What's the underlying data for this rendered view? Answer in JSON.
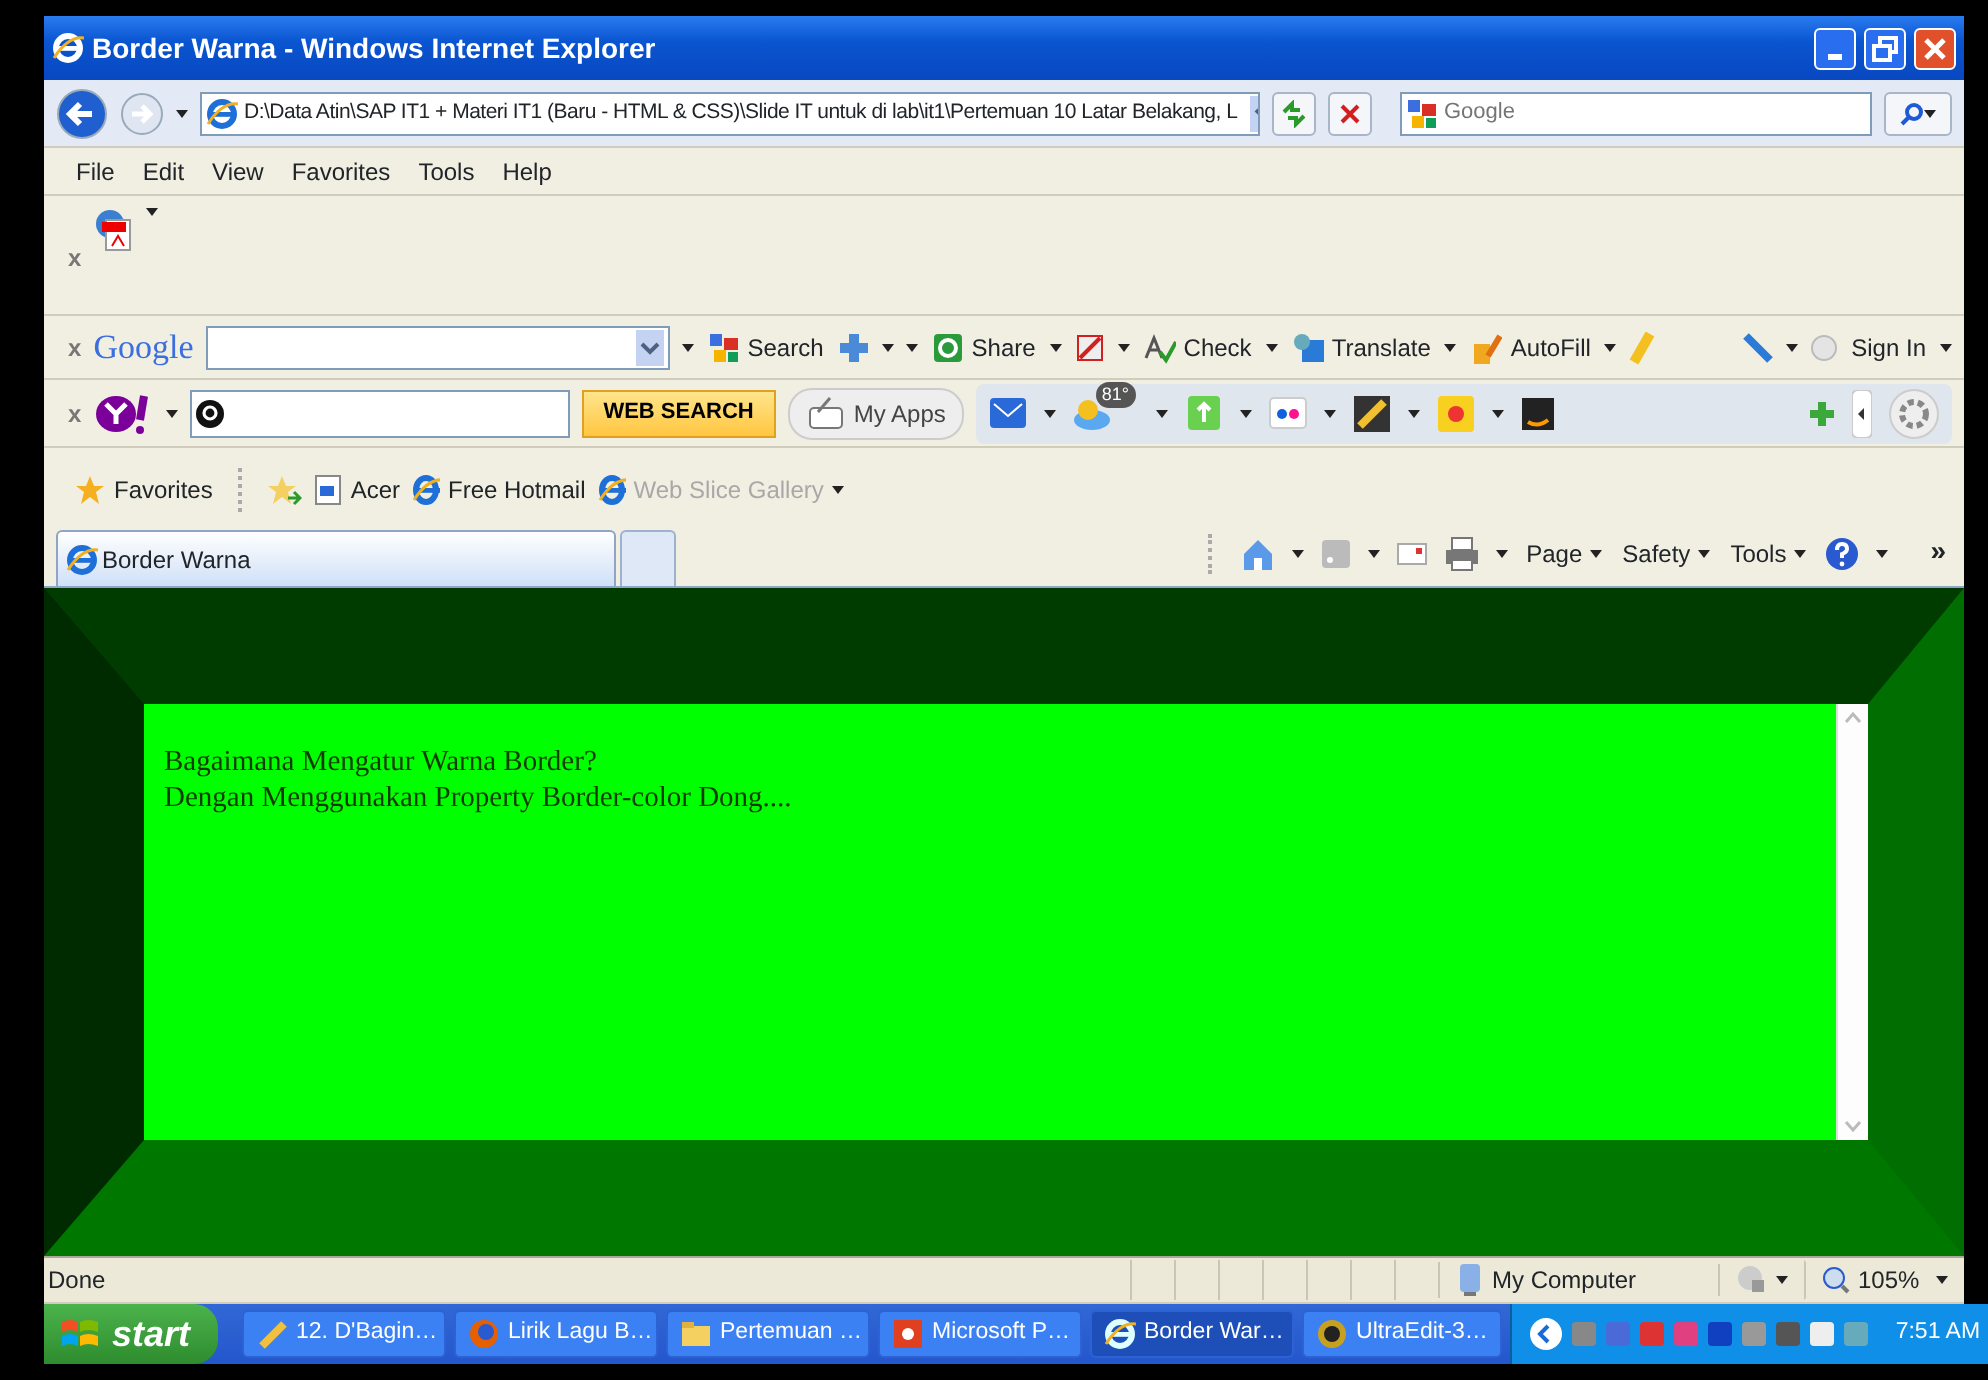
{
  "window": {
    "title": "Border Warna - Windows Internet Explorer"
  },
  "address_bar": {
    "url": "D:\\Data Atin\\SAP IT1 + Materi IT1 (Baru - HTML & CSS)\\Slide IT untuk di lab\\it1\\Pertemuan 10 Latar Belakang, L"
  },
  "search_box": {
    "placeholder": "Google"
  },
  "menu": [
    "File",
    "Edit",
    "View",
    "Favorites",
    "Tools",
    "Help"
  ],
  "pdf_toolbar": {
    "close": "x"
  },
  "google_toolbar": {
    "close": "x",
    "logo": "Google",
    "buttons": [
      "Search",
      "Share",
      "Check",
      "Translate",
      "AutoFill"
    ],
    "sign_in": "Sign In"
  },
  "yahoo_toolbar": {
    "close": "x",
    "search_button": "WEB SEARCH",
    "apps": "My Apps",
    "weather_badge": "81°"
  },
  "favorites_bar": {
    "favorites": "Favorites",
    "links": [
      {
        "label": "Acer",
        "disabled": false
      },
      {
        "label": "Free Hotmail",
        "disabled": false
      },
      {
        "label": "Web Slice Gallery",
        "disabled": true
      }
    ]
  },
  "tabs": [
    {
      "label": "Border Warna",
      "selected": true
    }
  ],
  "command_bar": {
    "menus": [
      "Page",
      "Safety",
      "Tools"
    ],
    "more": "»"
  },
  "page": {
    "lines": [
      "Bagaimana Mengatur Warna Border?",
      "Dengan Menggunakan Property Border-color Dong...."
    ]
  },
  "status_bar": {
    "text": "Done",
    "zone": "My Computer",
    "zoom": "105%"
  },
  "taskbar": {
    "start": "start",
    "items": [
      {
        "label": "12. D'Bagin…",
        "selected": false
      },
      {
        "label": "Lirik Lagu B…",
        "selected": false
      },
      {
        "label": "Pertemuan …",
        "selected": false
      },
      {
        "label": "Microsoft P…",
        "selected": false
      },
      {
        "label": "Border War…",
        "selected": true
      },
      {
        "label": "UltraEdit-3…",
        "selected": false
      }
    ],
    "clock": "7:51 AM"
  }
}
